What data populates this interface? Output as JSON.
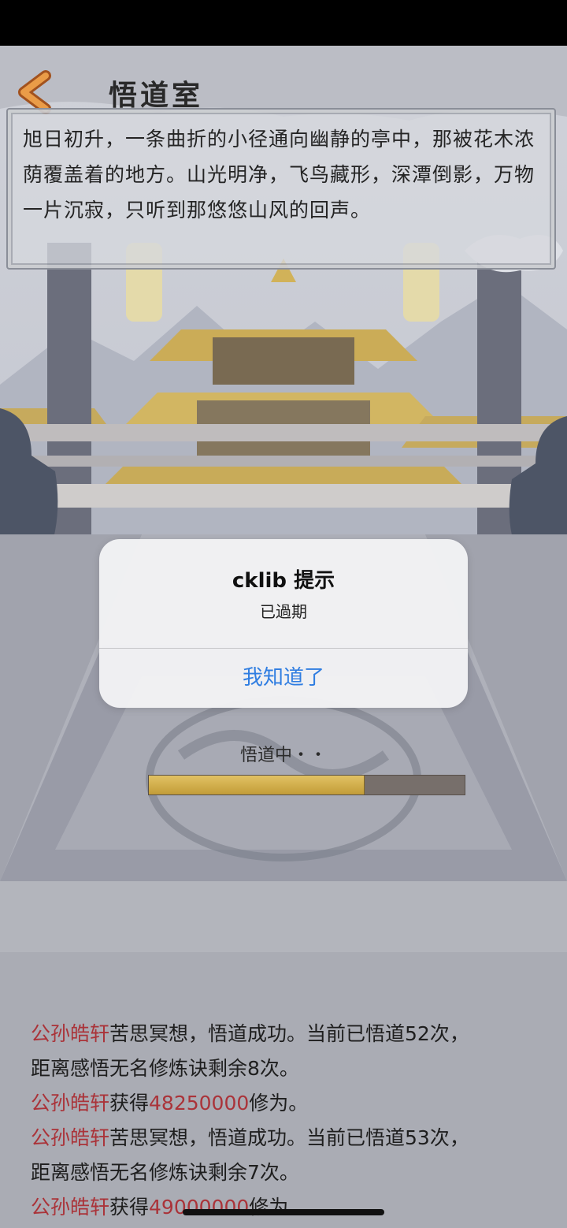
{
  "header": {
    "back_icon": "chevron-left-icon",
    "title": "悟道室"
  },
  "description": "旭日初升，一条曲折的小径通向幽静的亭中，那被花木浓荫覆盖着的地方。山光明净，飞鸟藏形，深潭倒影，万物一片沉寂，只听到那悠悠山风的回声。",
  "alert": {
    "title": "cklib 提示",
    "message": "已過期",
    "button": "我知道了"
  },
  "progress": {
    "label": "悟道中・・",
    "fraction": 0.68
  },
  "log": [
    {
      "name": "公孙皓轩",
      "text": "苦思冥想，悟道成功。当前已悟道52次，"
    },
    {
      "text": "距离感悟无名修炼诀剩余8次。"
    },
    {
      "name": "公孙皓轩",
      "text": "获得",
      "amount": "48250000",
      "suffix": "修为。"
    },
    {
      "name": "公孙皓轩",
      "text": "苦思冥想，悟道成功。当前已悟道53次，"
    },
    {
      "text": "距离感悟无名修炼诀剩余7次。"
    },
    {
      "name": "公孙皓轩",
      "text": "获得",
      "amount": "49000000",
      "suffix": "修为。"
    }
  ],
  "colors": {
    "accent": "#2f7de1",
    "highlight": "#b0353b",
    "progress": "#d9b44f"
  }
}
